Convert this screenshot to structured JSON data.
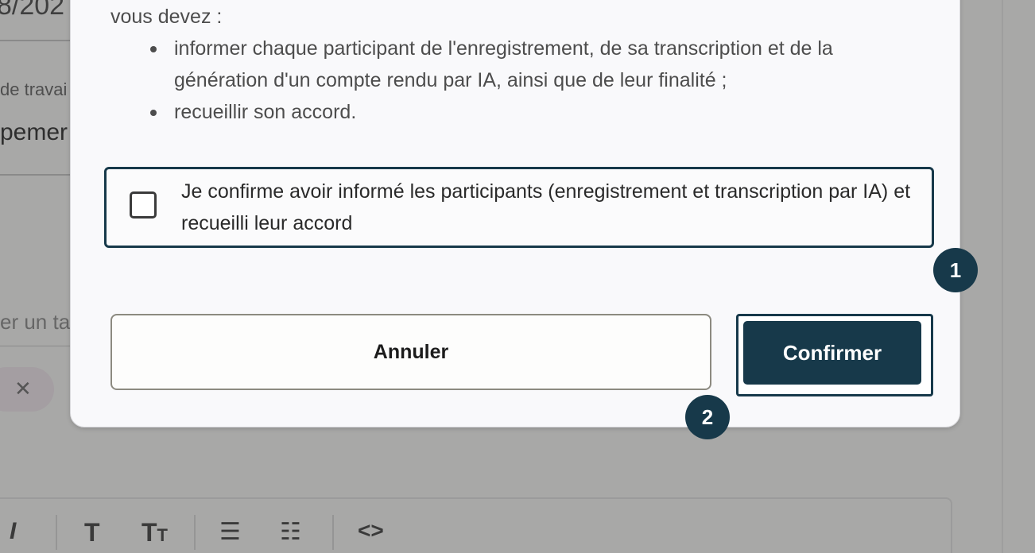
{
  "background": {
    "date_fragment": "8/202",
    "field_label_fragment": "de travai",
    "field_value_fragment": "pemer",
    "tag_input_fragment": "er un ta",
    "chip_remove_icon": "close-icon",
    "editor_toolbar": [
      "italic-icon",
      "text-icon",
      "text-size-icon",
      "bullet-list-icon",
      "numbered-list-icon",
      "code-icon"
    ]
  },
  "modal": {
    "intro": "vous devez :",
    "bullets": [
      "informer chaque participant de l'enregistrement, de sa transcription et de la génération d'un compte rendu par IA, ainsi que de leur finalité ;",
      "recueillir son accord."
    ],
    "consent_label": "Je confirme avoir informé les participants (enregistrement et transcription par IA) et recueilli leur accord",
    "consent_checked": false,
    "cancel_label": "Annuler",
    "confirm_label": "Confirmer"
  },
  "badges": {
    "one": "1",
    "two": "2"
  },
  "colors": {
    "primary": "#17394a",
    "overlay": "#a8a8a7",
    "modal_bg": "#f9f9fb"
  }
}
